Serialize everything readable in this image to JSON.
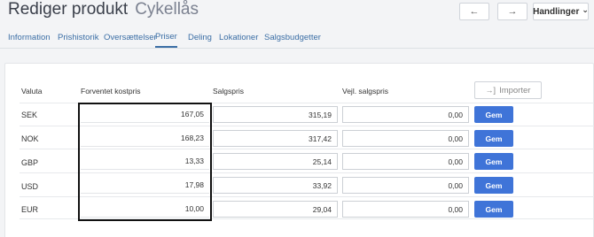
{
  "header": {
    "title": "Rediger produkt",
    "subtitle": "Cykellås",
    "prev_arrow": "←",
    "next_arrow": "→",
    "actions_label": "Handlinger",
    "actions_chevron": "⌄"
  },
  "tabs": [
    {
      "label": "Information"
    },
    {
      "label": "Prishistorik"
    },
    {
      "label": "Oversættelser"
    },
    {
      "label": "Priser",
      "active": true
    },
    {
      "label": "Deling"
    },
    {
      "label": "Lokationer"
    },
    {
      "label": "Salgsbudgetter"
    }
  ],
  "table": {
    "headers": {
      "currency": "Valuta",
      "expected_cost": "Forventet kostpris",
      "sale_price": "Salgspris",
      "recommended_price": "Vejl. salgspris"
    },
    "import_label": "Importer",
    "import_icon": "→]",
    "rows": [
      {
        "currency": "SEK",
        "cost": "167,05",
        "sale": "315,19",
        "recommended": "0,00",
        "save": "Gem"
      },
      {
        "currency": "NOK",
        "cost": "168,23",
        "sale": "317,42",
        "recommended": "0,00",
        "save": "Gem"
      },
      {
        "currency": "GBP",
        "cost": "13,33",
        "sale": "25,14",
        "recommended": "0,00",
        "save": "Gem"
      },
      {
        "currency": "USD",
        "cost": "17,98",
        "sale": "33,92",
        "recommended": "0,00",
        "save": "Gem"
      },
      {
        "currency": "EUR",
        "cost": "10,00",
        "sale": "29,04",
        "recommended": "0,00",
        "save": "Gem"
      }
    ]
  },
  "colors": {
    "accent": "#3f74d8",
    "tab_link": "#3b6ea5",
    "highlight": "#111111"
  }
}
